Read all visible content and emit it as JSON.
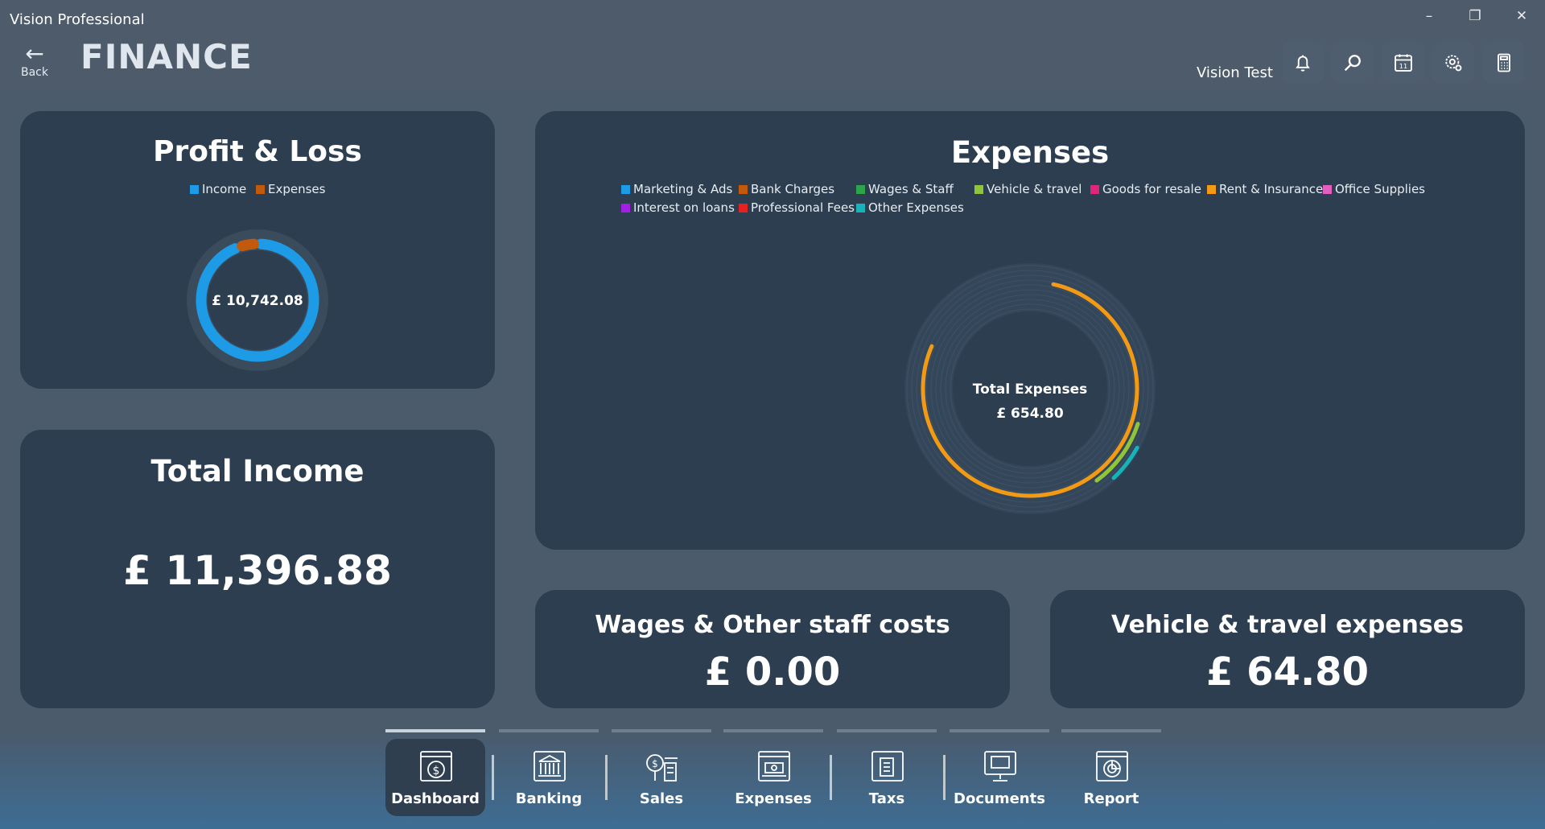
{
  "window": {
    "title": "Vision Professional",
    "controls": [
      "minimize",
      "restore",
      "close"
    ]
  },
  "header": {
    "back_label": "Back",
    "page_title": "FINANCE",
    "user": "Vision Test",
    "icons": [
      "bell-icon",
      "search-icon",
      "calendar-icon",
      "settings-icon",
      "calculator-icon"
    ],
    "calendar_day": "11"
  },
  "profit_loss": {
    "title": "Profit & Loss",
    "legend": [
      {
        "label": "Income",
        "color": "#1e9be6"
      },
      {
        "label": "Expenses",
        "color": "#c25a0e"
      }
    ],
    "center_value": "£ 10,742.08",
    "chart_data": {
      "type": "pie",
      "variant": "radial-ring",
      "labels": [
        "Income",
        "Expenses"
      ],
      "values": [
        11396.88,
        654.8
      ],
      "colors": [
        "#1e9be6",
        "#c25a0e"
      ]
    }
  },
  "total_income": {
    "title": "Total Income",
    "value": "£ 11,396.88"
  },
  "expenses": {
    "title": "Expenses",
    "legend": [
      {
        "label": "Marketing & Ads",
        "color": "#1e9be6"
      },
      {
        "label": "Bank Charges",
        "color": "#c25a0e"
      },
      {
        "label": "Wages & Staff",
        "color": "#2fa34a"
      },
      {
        "label": "Vehicle & travel",
        "color": "#8fc53a"
      },
      {
        "label": "Goods for resale",
        "color": "#e0257a"
      },
      {
        "label": "Rent & Insurance",
        "color": "#f29a14"
      },
      {
        "label": "Office Supplies",
        "color": "#e25fc0"
      },
      {
        "label": "Interest on loans",
        "color": "#a21fe6"
      },
      {
        "label": "Professional Fees",
        "color": "#e52121"
      },
      {
        "label": "Other Expenses",
        "color": "#16b3b8"
      }
    ],
    "center_title": "Total Expenses",
    "center_value": "£ 654.80",
    "chart_data": {
      "type": "pie",
      "variant": "radial-bar",
      "labels": [
        "Rent & Insurance",
        "Vehicle & travel",
        "Other Expenses"
      ],
      "fractions_of_full_ring": [
        0.78,
        0.1,
        0.05
      ],
      "colors": [
        "#f29a14",
        "#8fc53a",
        "#16b3b8"
      ]
    }
  },
  "wages": {
    "title": "Wages & Other staff costs",
    "value": "£ 0.00"
  },
  "vehicle": {
    "title": "Vehicle & travel expenses",
    "value": "£ 64.80"
  },
  "nav": {
    "items": [
      {
        "label": "Dashboard",
        "icon": "dashboard-icon",
        "active": true
      },
      {
        "label": "Banking",
        "icon": "bank-icon",
        "active": false
      },
      {
        "label": "Sales",
        "icon": "sales-icon",
        "active": false
      },
      {
        "label": "Expenses",
        "icon": "expenses-icon",
        "active": false
      },
      {
        "label": "Taxs",
        "icon": "taxes-icon",
        "active": false
      },
      {
        "label": "Documents",
        "icon": "documents-icon",
        "active": false
      },
      {
        "label": "Report",
        "icon": "report-icon",
        "active": false
      }
    ]
  }
}
